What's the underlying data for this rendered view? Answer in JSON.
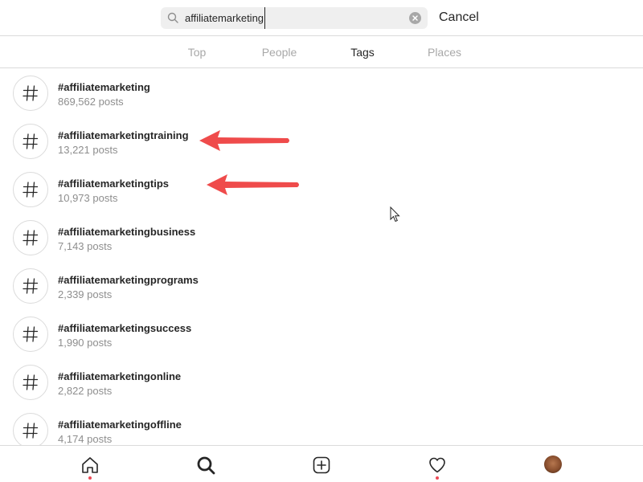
{
  "search": {
    "query": "affiliatemarketing",
    "cancel_label": "Cancel"
  },
  "tabs": [
    {
      "label": "Top"
    },
    {
      "label": "People"
    },
    {
      "label": "Tags",
      "active": true
    },
    {
      "label": "Places"
    }
  ],
  "results": [
    {
      "tag": "#affiliatemarketing",
      "count": "869,562 posts"
    },
    {
      "tag": "#affiliatemarketingtraining",
      "count": "13,221 posts"
    },
    {
      "tag": "#affiliatemarketingtips",
      "count": "10,973 posts"
    },
    {
      "tag": "#affiliatemarketingbusiness",
      "count": "7,143 posts"
    },
    {
      "tag": "#affiliatemarketingprograms",
      "count": "2,339 posts"
    },
    {
      "tag": "#affiliatemarketingsuccess",
      "count": "1,990 posts"
    },
    {
      "tag": "#affiliatemarketingonline",
      "count": "2,822 posts"
    },
    {
      "tag": "#affiliatemarketingoffline",
      "count": "4,174 posts"
    }
  ],
  "nav": {
    "items": [
      "home-icon",
      "search-icon",
      "new-post-icon",
      "activity-heart-icon",
      "profile-avatar"
    ]
  },
  "colors": {
    "arrow": "#ef4b4b",
    "notification_dot": "#ed4956",
    "muted_text": "#8e8e8e"
  }
}
